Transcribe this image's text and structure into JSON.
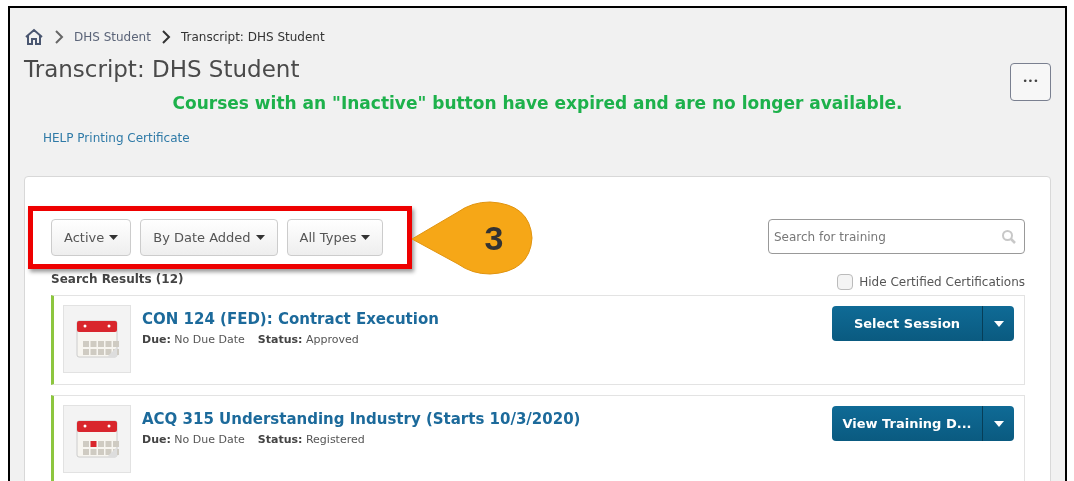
{
  "breadcrumb": [
    {
      "label": "DHS Student",
      "current": false
    },
    {
      "label": "Transcript: DHS Student",
      "current": true
    }
  ],
  "title": "Transcript: DHS Student",
  "options_button": "•••",
  "notice": "Courses with an \"Inactive\" button have expired and are no longer available.",
  "help_link": "HELP Printing Certificate",
  "filters": [
    {
      "label": "Active"
    },
    {
      "label": "By Date Added"
    },
    {
      "label": "All Types"
    }
  ],
  "callout": {
    "label": "3"
  },
  "search": {
    "placeholder": "Search for training"
  },
  "results_label": "Search Results (12)",
  "hide_certified": {
    "label": "Hide Certified Certifications",
    "checked": false
  },
  "courses": [
    {
      "title": "CON 124 (FED): Contract Execution",
      "due_label": "Due:",
      "due": "No Due Date",
      "status_label": "Status:",
      "status": "Approved",
      "action": "Select Session",
      "marked_day": false
    },
    {
      "title": "ACQ 315 Understanding Industry (Starts 10/3/2020)",
      "due_label": "Due:",
      "due": "No Due Date",
      "status_label": "Status:",
      "status": "Registered",
      "action": "View Training D...",
      "marked_day": true
    }
  ]
}
